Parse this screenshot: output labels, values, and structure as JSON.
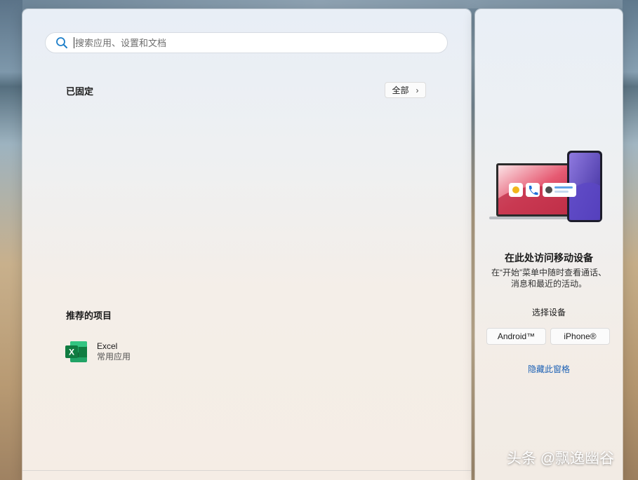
{
  "search": {
    "placeholder": "搜索应用、设置和文档"
  },
  "pinned": {
    "title": "已固定",
    "all_label": "全部"
  },
  "recommended": {
    "title": "推荐的项目",
    "items": [
      {
        "name": "Excel",
        "subtitle": "常用应用",
        "icon": "excel-icon"
      }
    ]
  },
  "phone_link": {
    "heading": "在此处访问移动设备",
    "description_line1": "在“开始”菜单中随时查看通话、",
    "description_line2": "消息和最近的活动。",
    "choose_label": "选择设备",
    "android_label": "Android™",
    "iphone_label": "iPhone®",
    "hide_label": "隐藏此窗格"
  },
  "watermark": {
    "text": "头条 @飘逸幽谷"
  },
  "colors": {
    "accent": "#1a5fb4",
    "excel_green": "#107c41"
  }
}
